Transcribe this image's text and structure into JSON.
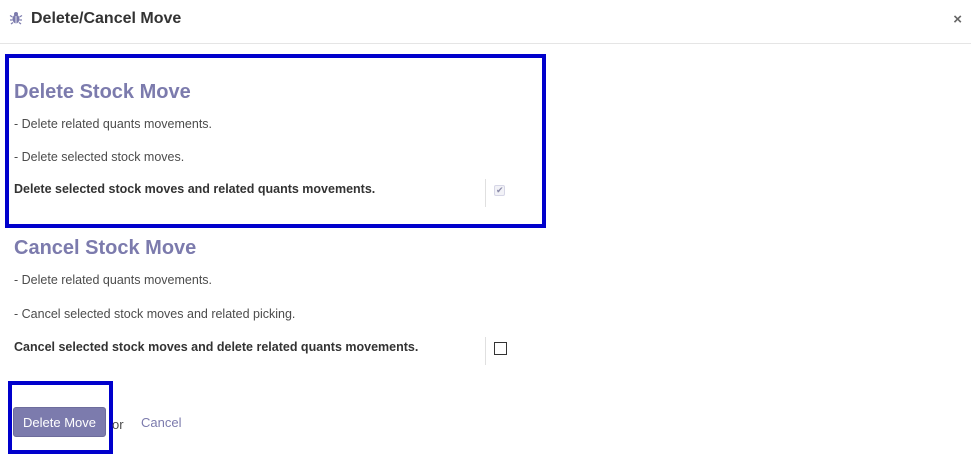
{
  "dialog": {
    "title": "Delete/Cancel Move",
    "close_label": "×"
  },
  "delete_section": {
    "title": "Delete Stock Move",
    "lines": [
      "- Delete related quants movements.",
      "- Delete selected stock moves."
    ],
    "field_label": "Delete selected stock moves and related quants movements.",
    "field_checked": true
  },
  "cancel_section": {
    "title": "Cancel Stock Move",
    "lines": [
      "- Delete related quants movements.",
      "- Cancel selected stock moves and related picking."
    ],
    "field_label": "Cancel selected stock moves and delete related quants movements.",
    "field_checked": false
  },
  "footer": {
    "primary_button": "Delete Move",
    "or_text": "or",
    "cancel_link": "Cancel"
  },
  "colors": {
    "accent": "#7c7bad",
    "highlight_box": "#0000cc"
  },
  "icons": {
    "header": "bug-icon",
    "close": "close-icon"
  }
}
